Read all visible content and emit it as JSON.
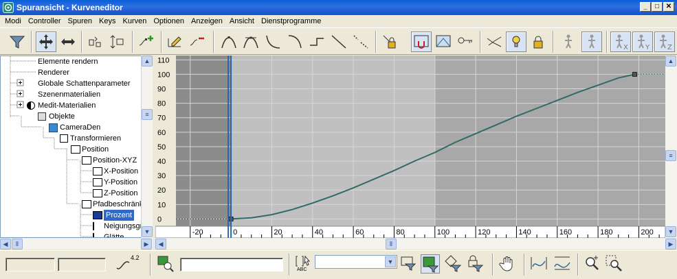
{
  "window": {
    "title": "Spuransicht - Kurveneditor",
    "app_icon": "3ds-max-icon",
    "controls": [
      "_",
      "□",
      "✕"
    ]
  },
  "menu": [
    "Modi",
    "Controller",
    "Spuren",
    "Keys",
    "Kurven",
    "Optionen",
    "Anzeigen",
    "Ansicht",
    "Dienstprogramme"
  ],
  "tree": {
    "items": [
      {
        "label": "Elemente rendern",
        "name": "tree-item-elemente-rendern"
      },
      {
        "label": "Renderer",
        "name": "tree-item-renderer"
      },
      {
        "label": "Globale Schattenparameter",
        "name": "tree-item-globale-schattenparameter"
      },
      {
        "label": "Szenenmaterialien",
        "name": "tree-item-szenenmaterialien"
      },
      {
        "label": "Medit-Materialien",
        "name": "tree-item-medit-materialien"
      },
      {
        "label": "Objekte",
        "name": "tree-item-objekte"
      },
      {
        "label": "CameraDen",
        "name": "tree-item-cameraden"
      },
      {
        "label": "Transformieren",
        "name": "tree-item-transformieren"
      },
      {
        "label": "Position",
        "name": "tree-item-position"
      },
      {
        "label": "Position-XYZ",
        "name": "tree-item-position-xyz"
      },
      {
        "label": "X-Position",
        "name": "tree-item-x-position"
      },
      {
        "label": "Y-Position",
        "name": "tree-item-y-position"
      },
      {
        "label": "Z-Position",
        "name": "tree-item-z-position"
      },
      {
        "label": "Pfadbeschränk",
        "name": "tree-item-pfadbeschraenkung"
      },
      {
        "label": "Prozent",
        "name": "tree-item-prozent",
        "selected": true
      },
      {
        "label": "Neigungsgr",
        "name": "tree-item-neigungsgrad"
      },
      {
        "label": "Glätte",
        "name": "tree-item-glaette"
      }
    ]
  },
  "chart_data": {
    "type": "line",
    "x_ticks": [
      -20,
      0,
      20,
      40,
      60,
      80,
      100,
      120,
      140,
      160,
      180,
      200
    ],
    "y_ticks": [
      0,
      10,
      20,
      30,
      40,
      50,
      60,
      70,
      80,
      90,
      100,
      110
    ],
    "xlim": [
      -27,
      213
    ],
    "ylim": [
      -5,
      113
    ],
    "time_slider_frame": 0,
    "active_range": [
      0,
      100
    ],
    "keys": [
      [
        0,
        0
      ],
      [
        198,
        100
      ]
    ],
    "series": [
      {
        "values_x": [
          0,
          10,
          20,
          30,
          40,
          50,
          60,
          70,
          80,
          90,
          100,
          110,
          120,
          130,
          140,
          150,
          160,
          170,
          180,
          190,
          198
        ],
        "values_y": [
          0,
          0.8,
          3,
          6.5,
          11,
          16,
          21.5,
          27.5,
          33.5,
          40,
          46,
          53,
          59,
          65,
          71,
          76.5,
          82,
          87.5,
          92.5,
          97.5,
          100
        ]
      }
    ],
    "colors": {
      "curve": "#2e6b66",
      "out_of_range": "#8c8c8c",
      "in_range": "#c0c0c0",
      "background": "#a8a8a8",
      "time_slider": "#2a64b0"
    }
  },
  "status": {
    "field1": "",
    "field2": "",
    "scale_label": "4.2",
    "name_field": "",
    "abc_label": "ABC",
    "selection_set": ""
  }
}
